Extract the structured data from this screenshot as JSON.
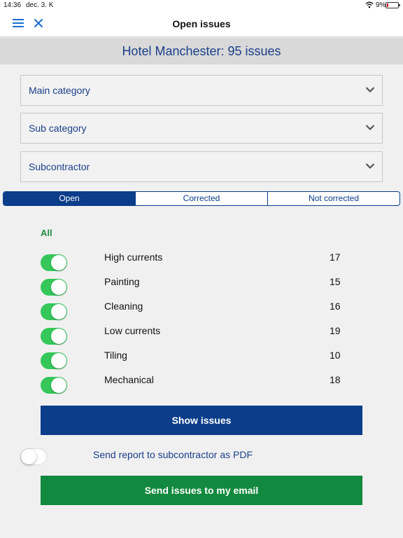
{
  "status_bar": {
    "time": "14:36",
    "date": "dec. 3. K",
    "battery": "9%"
  },
  "navbar": {
    "title": "Open issues",
    "menu_icon": "hamburger-icon",
    "close_icon": "close-icon"
  },
  "hotel_header": "Hotel Manchester: 95 issues",
  "filters": [
    {
      "label": "Main category"
    },
    {
      "label": "Sub category"
    },
    {
      "label": "Subcontractor"
    }
  ],
  "tabs": [
    {
      "label": "Open",
      "active": true
    },
    {
      "label": "Corrected",
      "active": false
    },
    {
      "label": "Not corrected",
      "active": false
    }
  ],
  "all_label": "All",
  "categories": [
    {
      "name": "High currents",
      "count": "17",
      "enabled": true
    },
    {
      "name": "Painting",
      "count": "15",
      "enabled": true
    },
    {
      "name": "Cleaning",
      "count": "16",
      "enabled": true
    },
    {
      "name": "Low currents",
      "count": "19",
      "enabled": true
    },
    {
      "name": "Tiling",
      "count": "10",
      "enabled": true
    },
    {
      "name": "Mechanical",
      "count": "18",
      "enabled": true
    }
  ],
  "show_issues_button": "Show issues",
  "pdf_report": {
    "label": "Send report to subcontractor as PDF",
    "enabled": false
  },
  "send_email_button": "Send issues to my email",
  "colors": {
    "primary_blue": "#0b3d8a",
    "green": "#12893e",
    "toggle_on": "#35c759",
    "link_blue": "#1a6fd1"
  }
}
